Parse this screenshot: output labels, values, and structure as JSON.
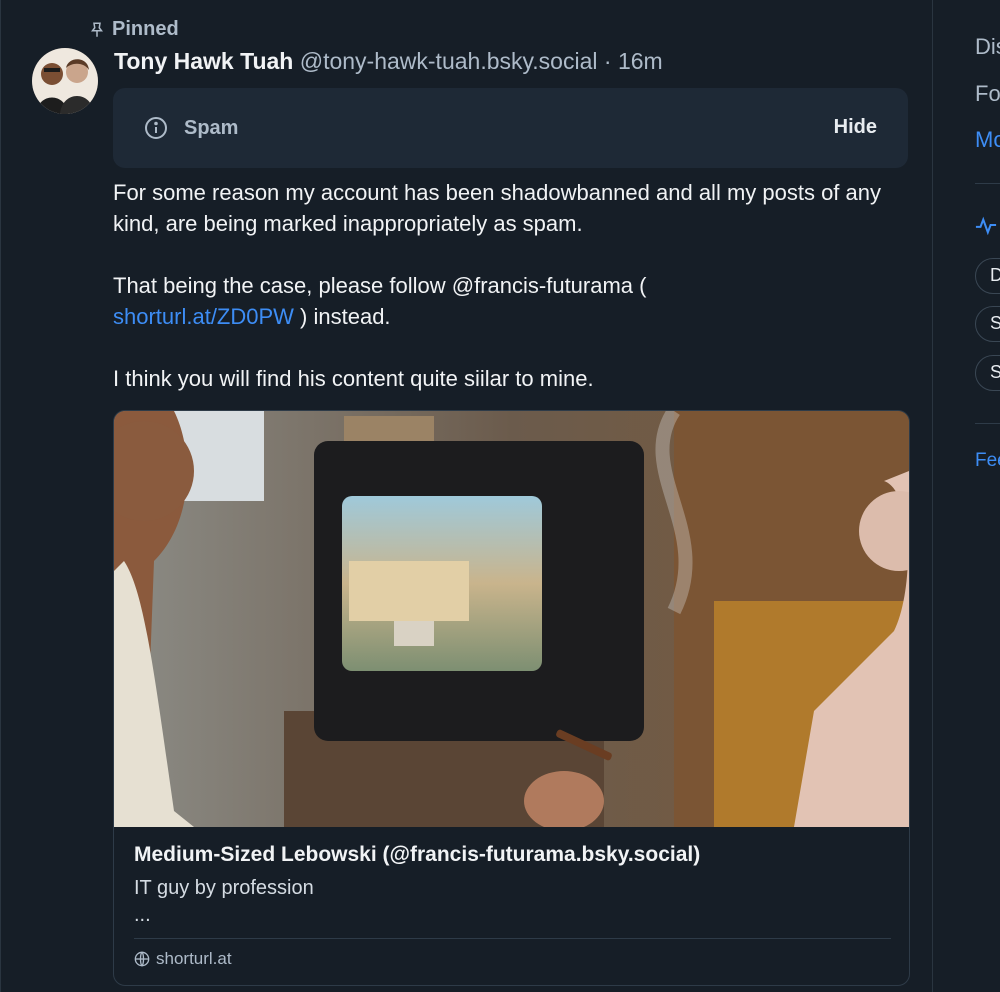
{
  "post": {
    "pinned_label": "Pinned",
    "author_name": "Tony Hawk Tuah",
    "author_handle": "@tony-hawk-tuah.bsky.social",
    "separator": " · ",
    "timestamp": "16m",
    "moderation": {
      "label": "Spam",
      "action": "Hide"
    },
    "text": {
      "p1": "For some reason my account has been shadowbanned and all my posts of any kind, are being marked inappropriately as spam.",
      "p2_before": "That being the case, please follow @francis-futurama (",
      "p2_link": "shorturl.at/ZD0PW",
      "p2_after": " ) instead.",
      "p3": "I think you will find his content quite siilar to mine."
    },
    "embed": {
      "title": "Medium-Sized Lebowski (@francis-futurama.bsky.social)",
      "description": "IT guy by profession",
      "more": "...",
      "domain": "shorturl.at"
    }
  },
  "sidebar": {
    "item1": "Dis",
    "item2": "Fo",
    "item3": "Mo",
    "pill1": "D",
    "pill2": "S",
    "pill3": "S",
    "item4": "Fee"
  },
  "colors": {
    "background": "#161e27",
    "link": "#3d8df5",
    "muted": "#aebbc9"
  }
}
